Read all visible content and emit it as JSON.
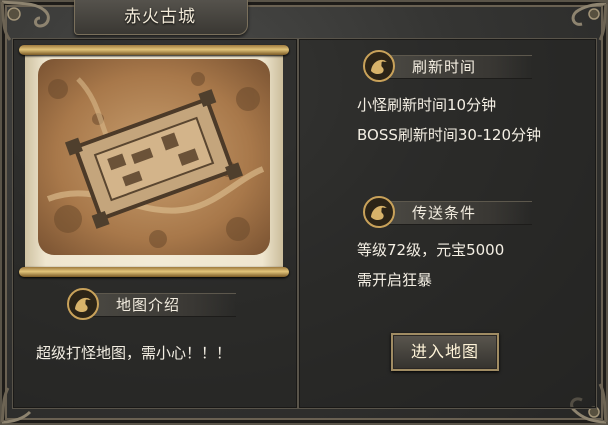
{
  "window": {
    "title": "赤火古城"
  },
  "sections": {
    "refresh": {
      "heading": "刷新时间",
      "lines": [
        "小怪刷新时间10分钟",
        "BOSS刷新时间30-120分钟"
      ]
    },
    "teleport": {
      "heading": "传送条件",
      "lines": [
        "等级72级，元宝5000",
        "需开启狂暴"
      ]
    },
    "intro": {
      "heading": "地图介绍",
      "text": "超级打怪地图，需小心！！！"
    }
  },
  "buttons": {
    "enter": "进入地图"
  },
  "icons": [
    "dragon-emblem-icon",
    "dragon-corner-ornament-icon",
    "map-scroll-icon"
  ],
  "colors": {
    "text": "#f4efe4",
    "gold": "#d8b36a",
    "panel_border": "#59544a"
  }
}
